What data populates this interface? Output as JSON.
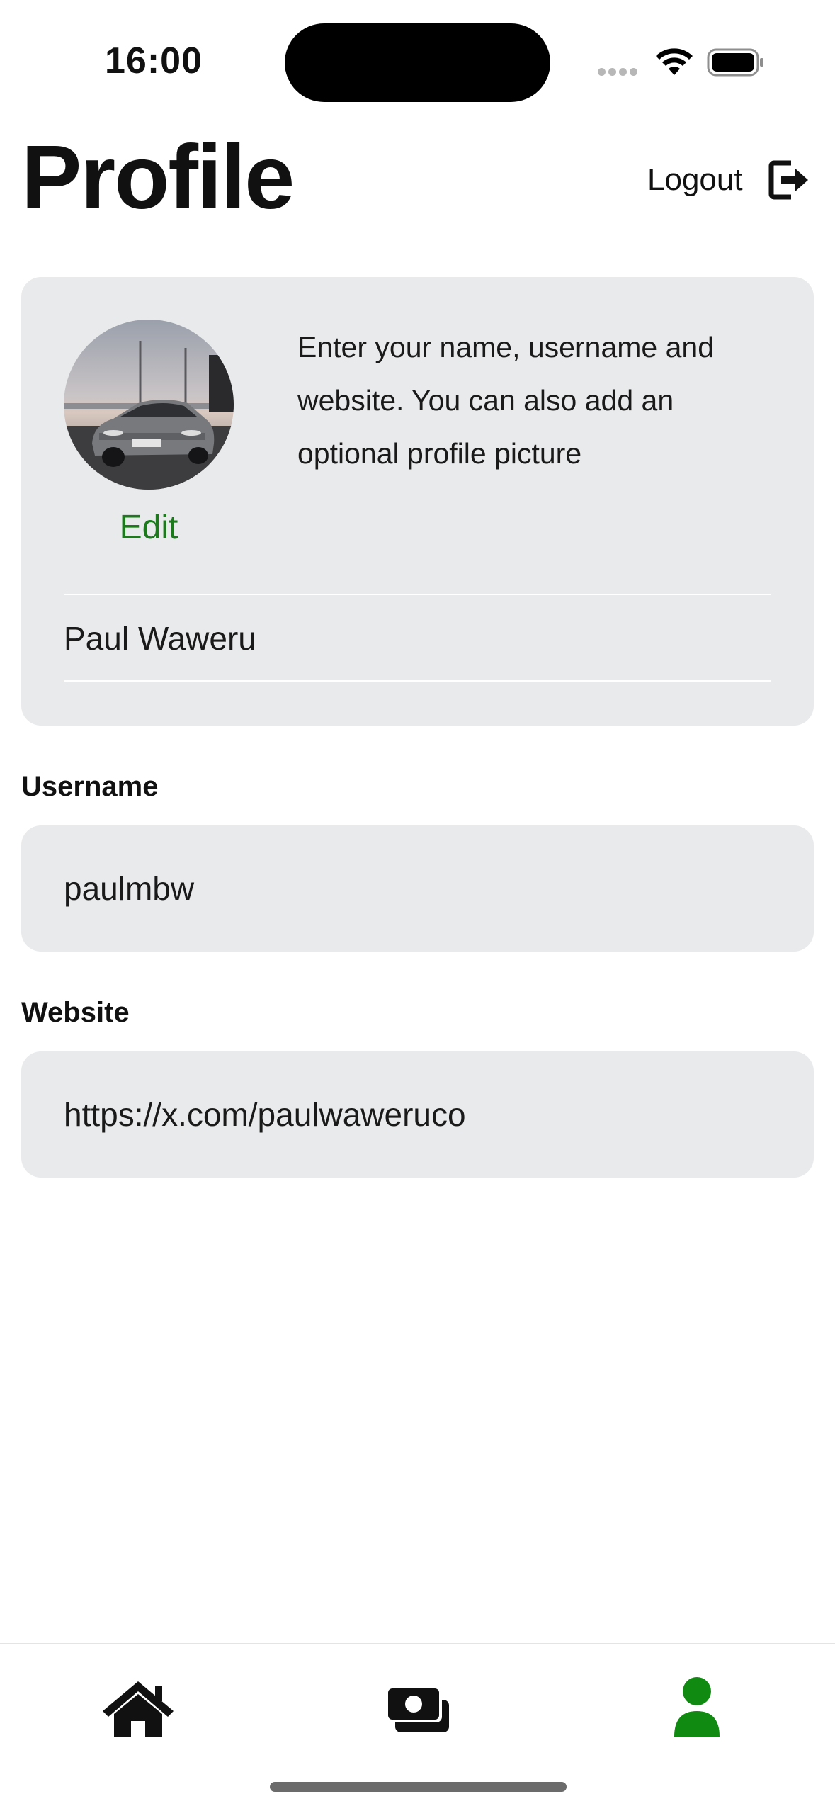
{
  "status_bar": {
    "time": "16:00"
  },
  "header": {
    "title": "Profile",
    "logout_label": "Logout"
  },
  "profile_card": {
    "edit_label": "Edit",
    "description": "Enter your name, username and website. You can also add an optional profile picture",
    "name_value": "Paul Waweru"
  },
  "username": {
    "label": "Username",
    "value": "paulmbw"
  },
  "website": {
    "label": "Website",
    "value": "https://x.com/paulwaweruco"
  },
  "tab_bar": {
    "items": [
      {
        "icon": "home-icon",
        "active": false
      },
      {
        "icon": "money-icon",
        "active": false
      },
      {
        "icon": "person-icon",
        "active": true
      }
    ],
    "active_color": "#118a11",
    "inactive_color": "#111111"
  },
  "colors": {
    "accent": "#1c7a1c",
    "card_background": "#e9eaec"
  }
}
